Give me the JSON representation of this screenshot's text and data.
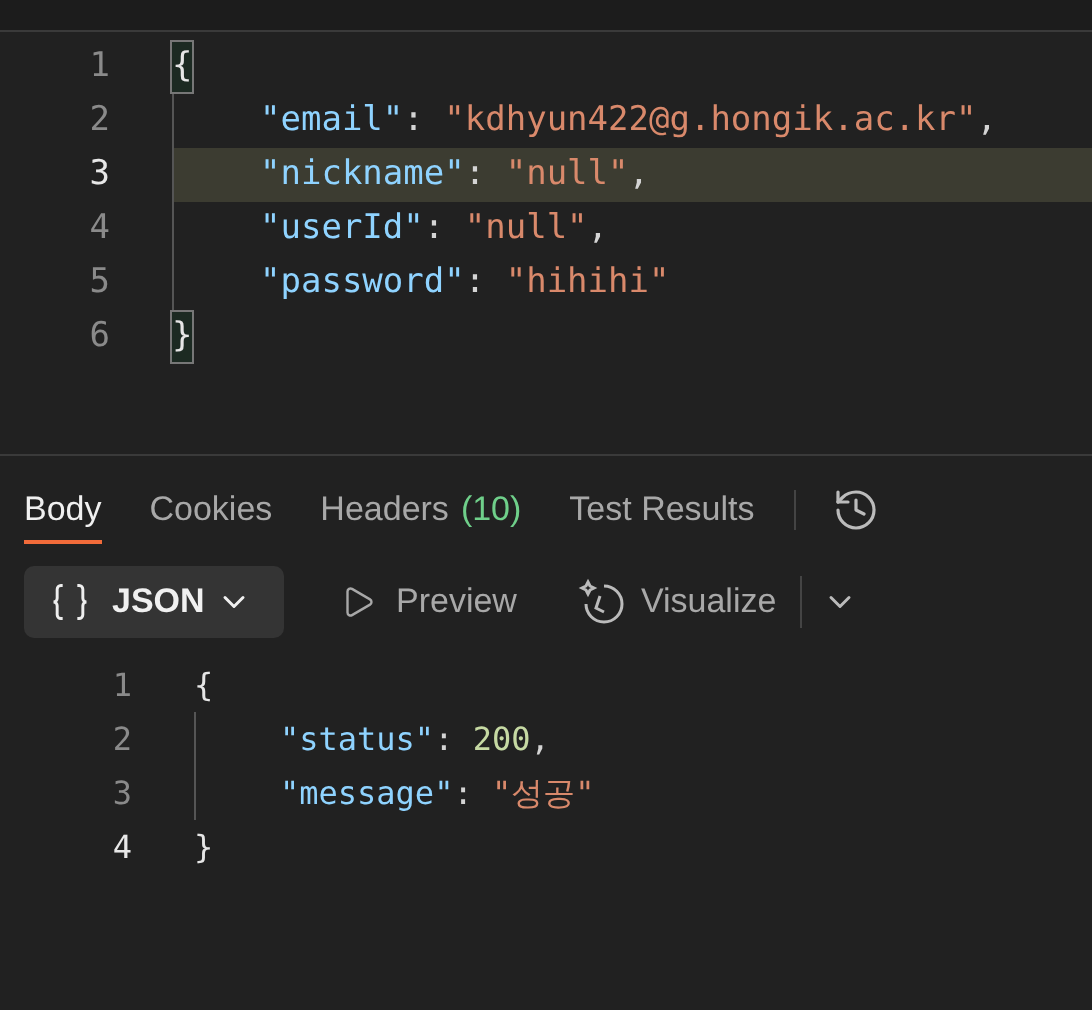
{
  "request_editor": {
    "lines": [
      {
        "number": "1",
        "current": false,
        "tokens": [
          {
            "kind": "bracket",
            "text": "{",
            "matched": true
          }
        ]
      },
      {
        "number": "2",
        "current": false,
        "tokens": [
          {
            "kind": "key",
            "text": "\"email\""
          },
          {
            "kind": "punct",
            "text": ": "
          },
          {
            "kind": "string",
            "text": "\"kdhyun422@g.hongik.ac.kr\""
          },
          {
            "kind": "punct",
            "text": ","
          }
        ]
      },
      {
        "number": "3",
        "current": true,
        "tokens": [
          {
            "kind": "key",
            "text": "\"nickname\""
          },
          {
            "kind": "punct",
            "text": ": "
          },
          {
            "kind": "string",
            "text": "\"null\""
          },
          {
            "kind": "punct",
            "text": ","
          }
        ]
      },
      {
        "number": "4",
        "current": false,
        "tokens": [
          {
            "kind": "key",
            "text": "\"userId\""
          },
          {
            "kind": "punct",
            "text": ": "
          },
          {
            "kind": "string",
            "text": "\"null\""
          },
          {
            "kind": "punct",
            "text": ","
          }
        ]
      },
      {
        "number": "5",
        "current": false,
        "tokens": [
          {
            "kind": "key",
            "text": "\"password\""
          },
          {
            "kind": "punct",
            "text": ": "
          },
          {
            "kind": "string",
            "text": "\"hihihi\""
          }
        ]
      },
      {
        "number": "6",
        "current": false,
        "tokens": [
          {
            "kind": "bracket",
            "text": "}",
            "matched": true
          }
        ]
      }
    ]
  },
  "response_tabs": [
    {
      "label": "Body",
      "selected": true
    },
    {
      "label": "Cookies",
      "selected": false
    },
    {
      "label": "Headers",
      "count": "(10)",
      "selected": false
    },
    {
      "label": "Test Results",
      "selected": false
    }
  ],
  "format_selector": {
    "label": "JSON"
  },
  "view_buttons": [
    {
      "kind": "preview",
      "label": "Preview"
    },
    {
      "kind": "visualize",
      "label": "Visualize"
    }
  ],
  "response_body": {
    "lines": [
      {
        "number": "1",
        "current": false,
        "tokens": [
          {
            "kind": "bracket",
            "text": "{",
            "matched": false
          }
        ]
      },
      {
        "number": "2",
        "current": false,
        "tokens": [
          {
            "kind": "key",
            "text": "\"status\""
          },
          {
            "kind": "punct",
            "text": ": "
          },
          {
            "kind": "number",
            "text": "200"
          },
          {
            "kind": "punct",
            "text": ","
          }
        ]
      },
      {
        "number": "3",
        "current": false,
        "tokens": [
          {
            "kind": "key",
            "text": "\"message\""
          },
          {
            "kind": "punct",
            "text": ": "
          },
          {
            "kind": "string",
            "text": "\"성공\""
          }
        ]
      },
      {
        "number": "4",
        "current": true,
        "tokens": [
          {
            "kind": "bracket",
            "text": "}",
            "matched": false
          }
        ]
      }
    ]
  }
}
